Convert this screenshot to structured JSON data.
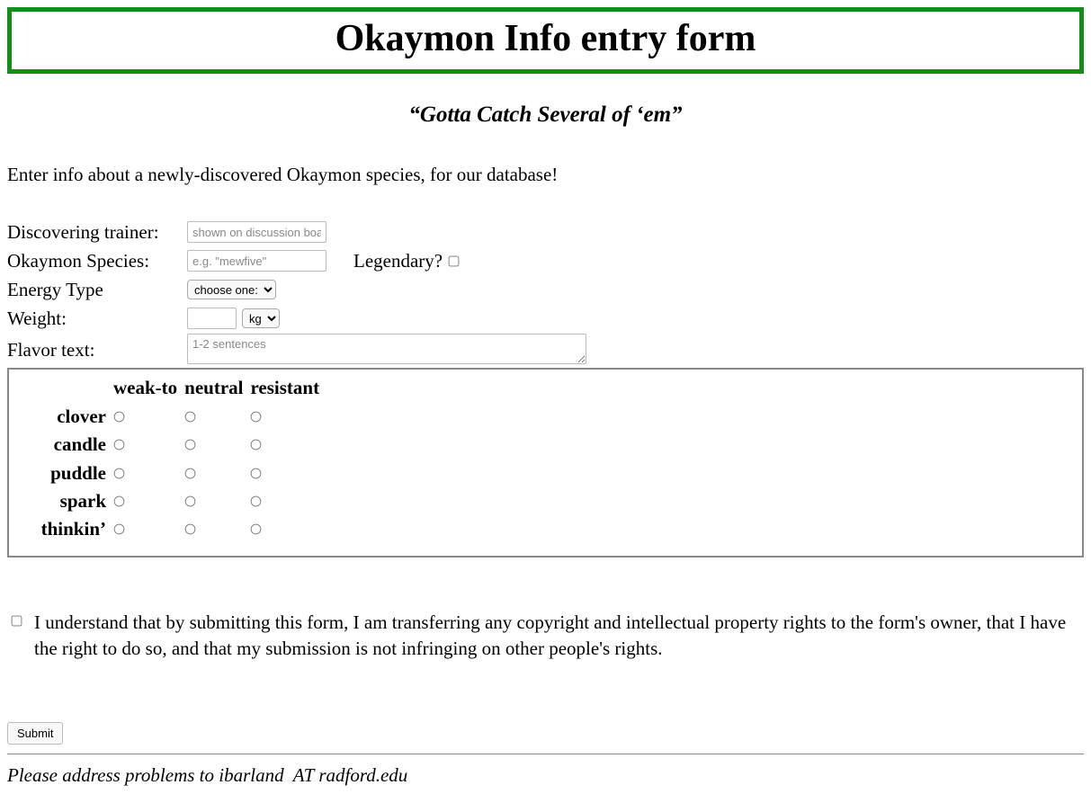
{
  "title": "Okaymon Info entry form",
  "tagline": "“Gotta Catch Several of ‘em”",
  "intro": "Enter info about a newly-discovered Okaymon species, for our database!",
  "fields": {
    "trainer_label": "Discovering trainer:",
    "trainer_placeholder": "shown on discussion boards",
    "species_label": "Okaymon Species:",
    "species_placeholder": "e.g. \"mewfive\"",
    "legendary_label": "Legendary?",
    "energy_label": "Energy Type",
    "energy_selected": "choose one:",
    "weight_label": "Weight:",
    "weight_unit_selected": "kg",
    "flavor_label": "Flavor text:",
    "flavor_placeholder": "1-2 sentences"
  },
  "resistance": {
    "columns": [
      "weak-to",
      "neutral",
      "resistant"
    ],
    "rows": [
      "clover",
      "candle",
      "puddle",
      "spark",
      "thinkin’"
    ]
  },
  "consent": "I understand that by submitting this form, I am transferring any copyright and intellectual property rights to the form's owner, that I have the right to do so, and that my submission is not infringing on other people's rights.",
  "submit_label": "Submit",
  "footer": "Please address problems to ibarland  AT radford.edu"
}
